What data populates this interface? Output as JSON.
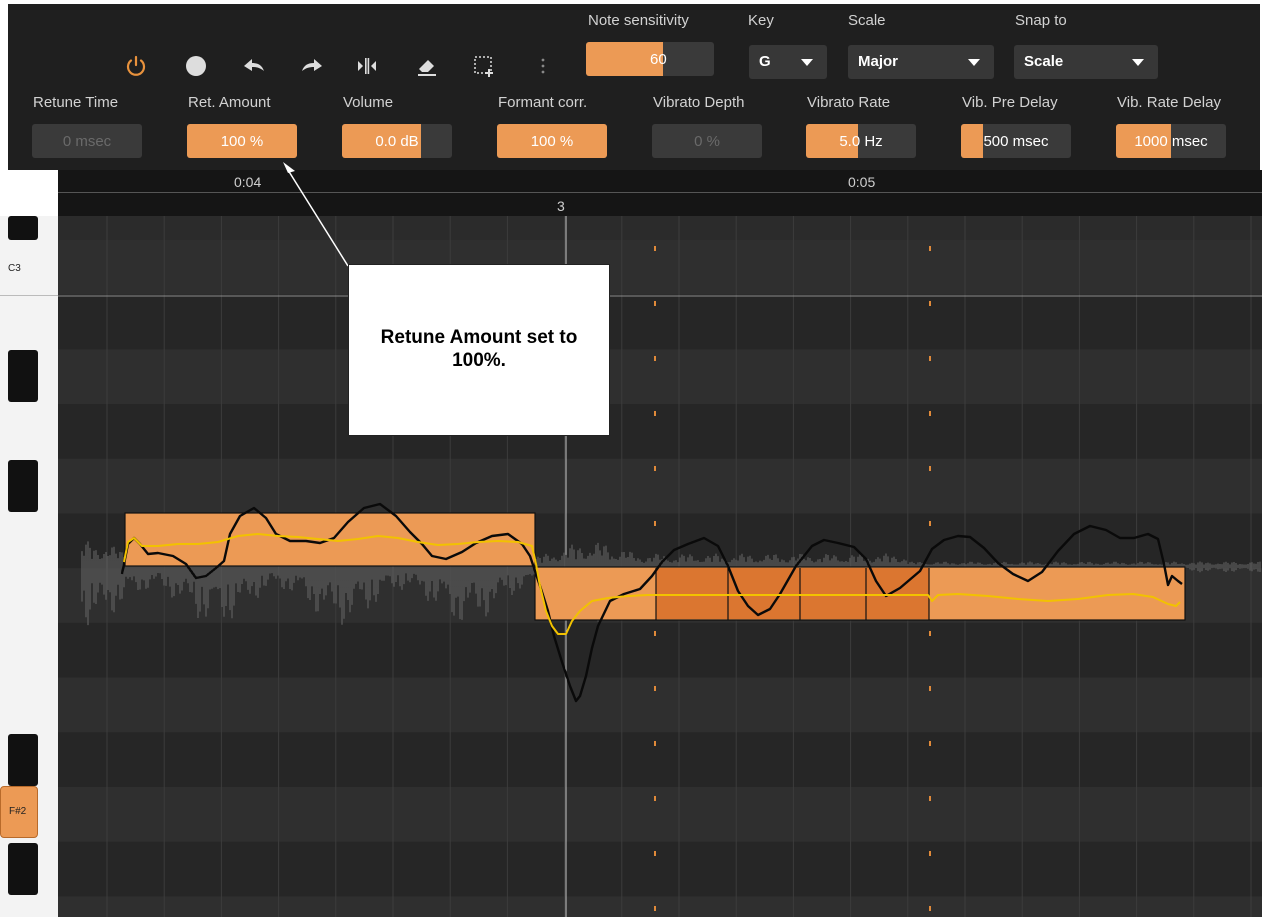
{
  "toolbar": {
    "note_sensitivity_label": "Note sensitivity",
    "note_sensitivity_value": "60",
    "note_sensitivity_level": 0.6,
    "key_label": "Key",
    "key_value": "G",
    "scale_label": "Scale",
    "scale_value": "Major",
    "snap_label": "Snap to",
    "snap_value": "Scale",
    "icons": [
      "power-icon",
      "record-icon",
      "undo-icon",
      "redo-icon",
      "split-icon",
      "eraser-icon",
      "select-icon",
      "more-icon"
    ],
    "accent_color": "#ec9a55",
    "power_color": "#e8923d"
  },
  "params": [
    {
      "label": "Retune Time",
      "value": "0 msec",
      "fill": 0,
      "enabled": false
    },
    {
      "label": "Ret. Amount",
      "value": "100 %",
      "fill": 1.0,
      "enabled": true
    },
    {
      "label": "Volume",
      "value": "0.0 dB",
      "fill": 0.72,
      "enabled": true
    },
    {
      "label": "Formant corr.",
      "value": "100 %",
      "fill": 1.0,
      "enabled": true
    },
    {
      "label": "Vibrato Depth",
      "value": "0 %",
      "fill": 0,
      "enabled": false
    },
    {
      "label": "Vibrato Rate",
      "value": "5.0 Hz",
      "fill": 0.47,
      "enabled": true
    },
    {
      "label": "Vib. Pre Delay",
      "value": "500 msec",
      "fill": 0.2,
      "enabled": true
    },
    {
      "label": "Vib. Rate Delay",
      "value": "1000 msec",
      "fill": 0.5,
      "enabled": true
    }
  ],
  "ruler": {
    "time1": "0:04",
    "time2": "0:05",
    "bar": "3"
  },
  "keyboard": {
    "c3": "C3",
    "active": "F#2"
  },
  "callout": {
    "text": "Retune Amount set to 100%."
  }
}
